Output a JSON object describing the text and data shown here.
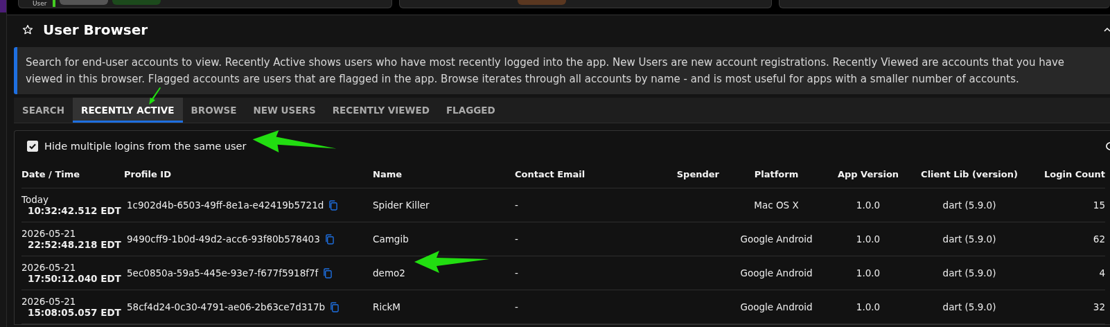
{
  "top_strip": {
    "label": "User"
  },
  "panel": {
    "title": "User Browser",
    "starred": false
  },
  "info": "Search for end-user accounts to view. Recently Active shows users who have most recently logged into the app. New Users are new account registrations. Recently Viewed are accounts that you have viewed in this browser. Flagged accounts are users that are flagged in the app. Browse iterates through all accounts by name - and is most useful for apps with a smaller number of accounts.",
  "tabs": [
    {
      "label": "SEARCH",
      "selected": false
    },
    {
      "label": "RECENTLY ACTIVE",
      "selected": true
    },
    {
      "label": "BROWSE",
      "selected": false
    },
    {
      "label": "NEW USERS",
      "selected": false
    },
    {
      "label": "RECENTLY VIEWED",
      "selected": false
    },
    {
      "label": "FLAGGED",
      "selected": false
    }
  ],
  "filter": {
    "label": "Hide multiple logins from the same user",
    "checked": true
  },
  "table": {
    "columns": [
      "Date / Time",
      "Profile ID",
      "Name",
      "Contact Email",
      "Spender",
      "Platform",
      "App Version",
      "Client Lib (version)",
      "Login Count"
    ],
    "rows": [
      {
        "date": "Today",
        "time": "10:32:42.512 EDT",
        "profile_id": "1c902d4b-6503-49ff-8e1a-e42419b5721d",
        "name": "Spider Killer",
        "email": "-",
        "platform": "Mac OS X",
        "app_version": "1.0.0",
        "client_lib": "dart (5.9.0)",
        "login_count": "15"
      },
      {
        "date": "2026-05-21",
        "time": "22:52:48.218 EDT",
        "profile_id": "9490cff9-1b0d-49d2-acc6-93f80b578403",
        "name": "Camgib",
        "email": "-",
        "platform": "Google Android",
        "app_version": "1.0.0",
        "client_lib": "dart (5.9.0)",
        "login_count": "62"
      },
      {
        "date": "2026-05-21",
        "time": "17:50:12.040 EDT",
        "profile_id": "5ec0850a-59a5-445e-93e7-f677f5918f7f",
        "name": "demo2",
        "email": "-",
        "platform": "Google Android",
        "app_version": "1.0.0",
        "client_lib": "dart (5.9.0)",
        "login_count": "4"
      },
      {
        "date": "2026-05-21",
        "time": "15:08:05.057 EDT",
        "profile_id": "58cf4d24-0c30-4791-ae06-2b63ce7d317b",
        "name": "RickM",
        "email": "-",
        "platform": "Google Android",
        "app_version": "1.0.0",
        "client_lib": "dart (5.9.0)",
        "login_count": "32"
      }
    ]
  }
}
